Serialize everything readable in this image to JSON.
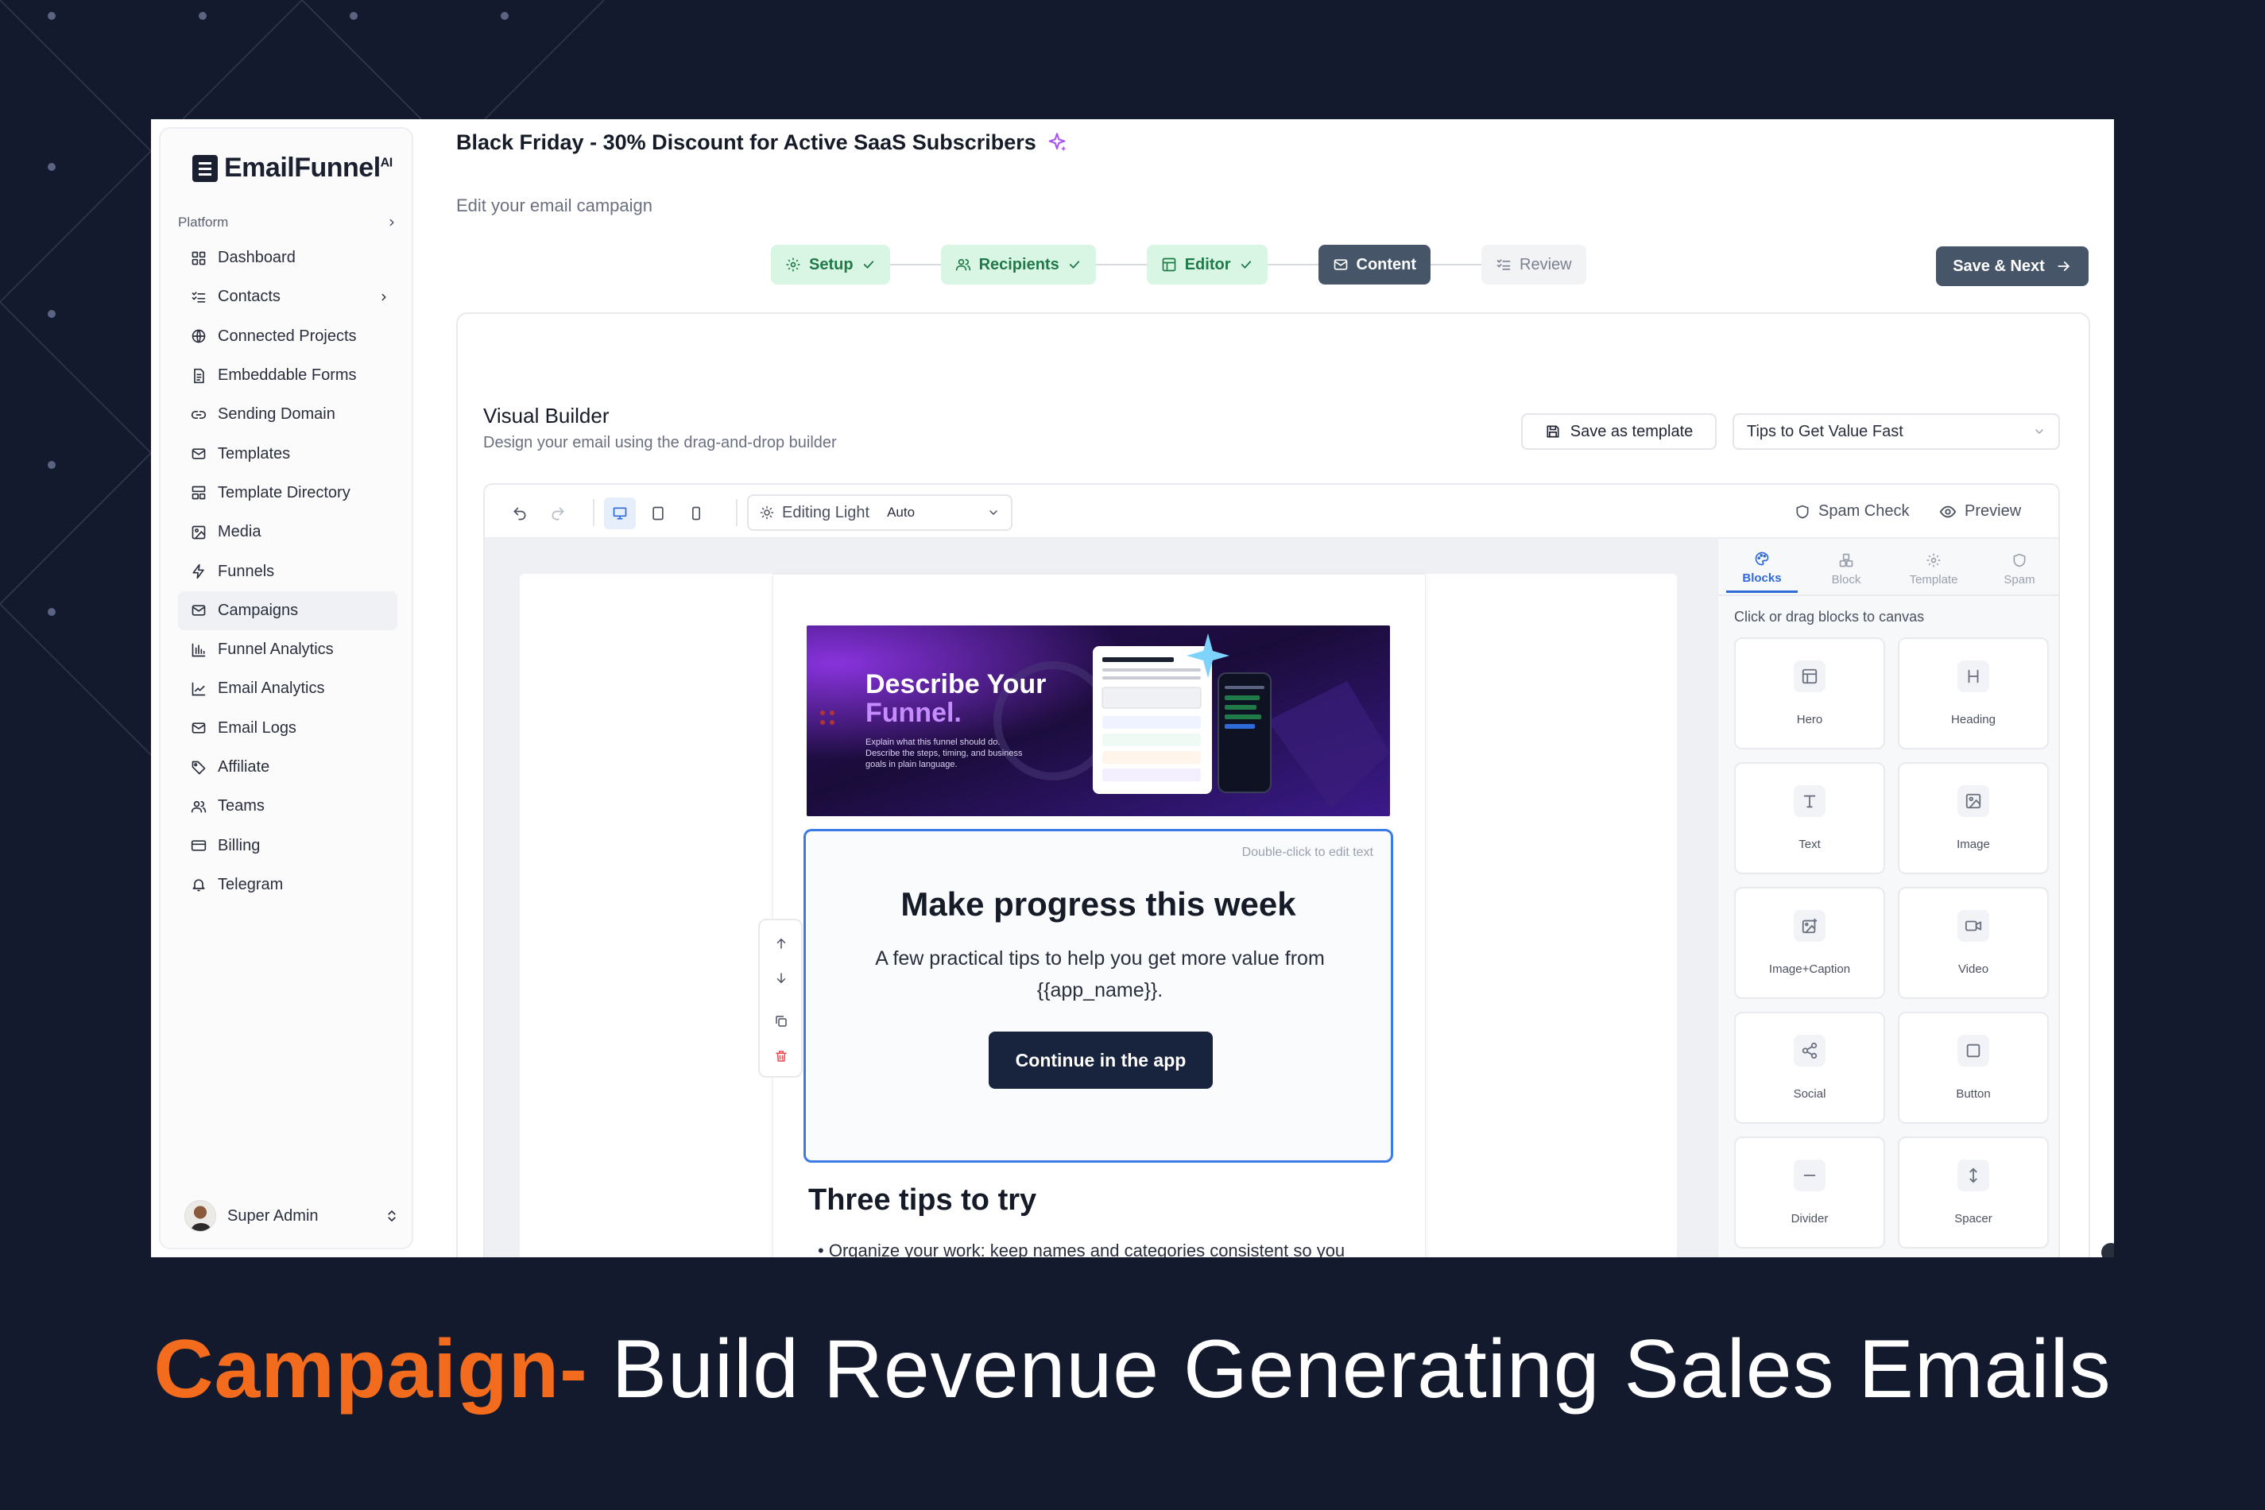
{
  "brand": {
    "name": "EmailFunnel",
    "suffix": "AI"
  },
  "sidebar": {
    "group_label": "Platform",
    "items": [
      {
        "label": "Dashboard",
        "icon": "dashboard-icon"
      },
      {
        "label": "Contacts",
        "icon": "contacts-icon",
        "has_children": true
      },
      {
        "label": "Connected Projects",
        "icon": "globe-icon"
      },
      {
        "label": "Embeddable Forms",
        "icon": "file-icon"
      },
      {
        "label": "Sending Domain",
        "icon": "link-icon"
      },
      {
        "label": "Templates",
        "icon": "mail-icon"
      },
      {
        "label": "Template Directory",
        "icon": "layout-icon"
      },
      {
        "label": "Media",
        "icon": "image-icon"
      },
      {
        "label": "Funnels",
        "icon": "bolt-icon"
      },
      {
        "label": "Campaigns",
        "icon": "mail-icon",
        "active": true
      },
      {
        "label": "Funnel Analytics",
        "icon": "bar-chart-icon"
      },
      {
        "label": "Email Analytics",
        "icon": "line-chart-icon"
      },
      {
        "label": "Email Logs",
        "icon": "mail-icon"
      },
      {
        "label": "Affiliate",
        "icon": "tag-icon"
      },
      {
        "label": "Teams",
        "icon": "users-icon"
      },
      {
        "label": "Billing",
        "icon": "card-icon"
      },
      {
        "label": "Telegram",
        "icon": "bell-icon"
      }
    ],
    "user_name": "Super Admin"
  },
  "header": {
    "title": "Black Friday - 30% Discount for Active SaaS Subscribers",
    "subtitle": "Edit your email campaign"
  },
  "stepper": {
    "steps": [
      {
        "label": "Setup",
        "state": "done"
      },
      {
        "label": "Recipients",
        "state": "done"
      },
      {
        "label": "Editor",
        "state": "done"
      },
      {
        "label": "Content",
        "state": "active"
      },
      {
        "label": "Review",
        "state": "todo"
      }
    ],
    "save_next_label": "Save & Next"
  },
  "builder": {
    "title": "Visual Builder",
    "subtitle": "Design your email using the drag-and-drop builder",
    "save_template_label": "Save as template",
    "template_selected": "Tips to Get Value Fast",
    "editing_mode_label": "Editing Light",
    "editing_mode_value": "Auto",
    "spam_check_label": "Spam Check",
    "preview_label": "Preview"
  },
  "email": {
    "hero": {
      "title_line1": "Describe Your",
      "title_line2": "Funnel.",
      "description": "Explain what this funnel should do. Describe the steps, timing, and business goals in plain language."
    },
    "selected_block": {
      "hint": "Double-click to edit text",
      "heading": "Make progress this week",
      "text": "A few practical tips to help you get more value from {{app_name}}.",
      "button_label": "Continue in the app"
    },
    "section_heading": "Three tips to try",
    "bullet_1": "Organize your work: keep names and categories consistent so you"
  },
  "blocks_panel": {
    "tabs": [
      {
        "label": "Blocks",
        "icon": "palette-icon",
        "active": true
      },
      {
        "label": "Block",
        "icon": "block-icon"
      },
      {
        "label": "Template",
        "icon": "gear-icon"
      },
      {
        "label": "Spam",
        "icon": "shield-icon"
      }
    ],
    "hint": "Click or drag blocks to canvas",
    "blocks": [
      {
        "label": "Hero",
        "icon": "hero-icon"
      },
      {
        "label": "Heading",
        "icon": "heading-icon"
      },
      {
        "label": "Text",
        "icon": "text-icon"
      },
      {
        "label": "Image",
        "icon": "image-icon"
      },
      {
        "label": "Image+Caption",
        "icon": "image-caption-icon"
      },
      {
        "label": "Video",
        "icon": "video-icon"
      },
      {
        "label": "Social",
        "icon": "share-icon"
      },
      {
        "label": "Button",
        "icon": "button-icon"
      },
      {
        "label": "Divider",
        "icon": "divider-icon"
      },
      {
        "label": "Spacer",
        "icon": "spacer-icon"
      }
    ]
  },
  "caption": {
    "highlight": "Campaign-",
    "rest": " Build Revenue Generating Sales Emails"
  },
  "colors": {
    "background": "#141a2e",
    "accent_orange": "#f36b1c",
    "step_done_bg": "#d9f6e4",
    "step_done_text": "#1f7a48",
    "step_active_bg": "#475569",
    "primary_button": "#18233d",
    "selection_blue": "#3b7be6"
  }
}
